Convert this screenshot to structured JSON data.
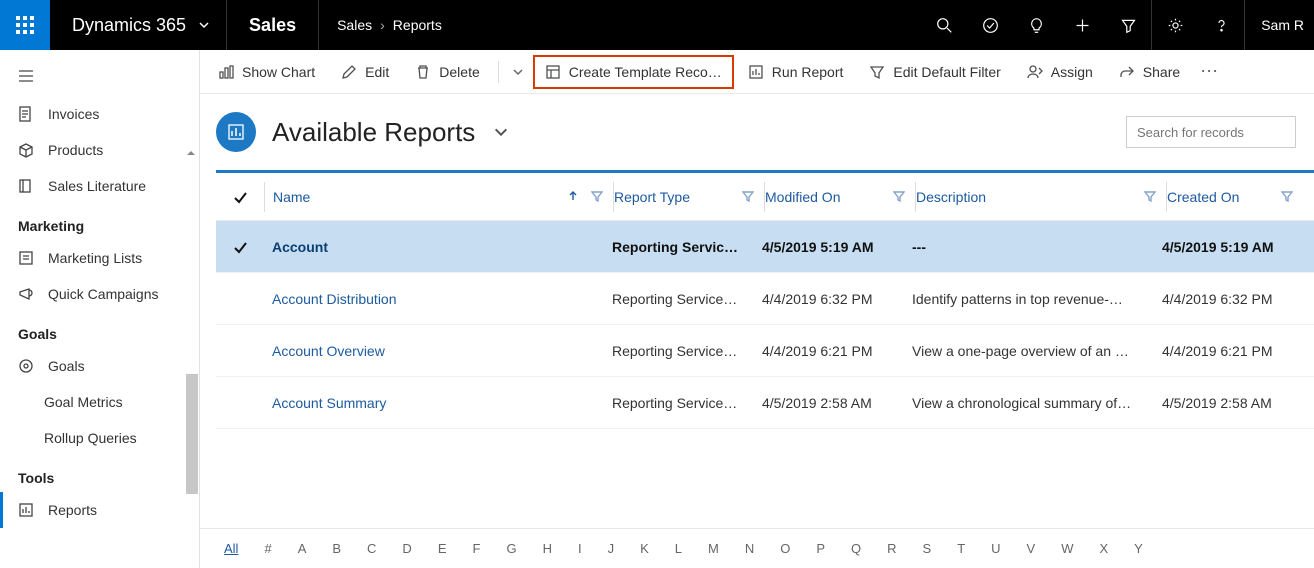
{
  "topbar": {
    "brand": "Dynamics 365",
    "area": "Sales",
    "breadcrumb": [
      "Sales",
      "Reports"
    ],
    "user": "Sam R"
  },
  "sidebar": {
    "items1": [
      {
        "label": "Invoices"
      },
      {
        "label": "Products"
      },
      {
        "label": "Sales Literature"
      }
    ],
    "group_marketing": "Marketing",
    "items2": [
      {
        "label": "Marketing Lists"
      },
      {
        "label": "Quick Campaigns"
      }
    ],
    "group_goals": "Goals",
    "items3": [
      {
        "label": "Goals"
      },
      {
        "label": "Goal Metrics"
      },
      {
        "label": "Rollup Queries"
      }
    ],
    "group_tools": "Tools",
    "items4": [
      {
        "label": "Reports"
      }
    ]
  },
  "commands": {
    "show_chart": "Show Chart",
    "edit": "Edit",
    "delete": "Delete",
    "create_template": "Create Template Reco…",
    "run_report": "Run Report",
    "edit_default_filter": "Edit Default Filter",
    "assign": "Assign",
    "share": "Share"
  },
  "view": {
    "title": "Available Reports",
    "search_placeholder": "Search for records"
  },
  "grid": {
    "columns": {
      "name": "Name",
      "report_type": "Report Type",
      "modified_on": "Modified On",
      "description": "Description",
      "created_on": "Created On"
    },
    "rows": [
      {
        "selected": true,
        "name": "Account",
        "type": "Reporting Servic…",
        "modified": "4/5/2019 5:19 AM",
        "description": "---",
        "created": "4/5/2019 5:19 AM"
      },
      {
        "selected": false,
        "name": "Account Distribution",
        "type": "Reporting Service…",
        "modified": "4/4/2019 6:32 PM",
        "description": "Identify patterns in top revenue-…",
        "created": "4/4/2019 6:32 PM"
      },
      {
        "selected": false,
        "name": "Account Overview",
        "type": "Reporting Service…",
        "modified": "4/4/2019 6:21 PM",
        "description": "View a one-page overview of an …",
        "created": "4/4/2019 6:21 PM"
      },
      {
        "selected": false,
        "name": "Account Summary",
        "type": "Reporting Service…",
        "modified": "4/5/2019 2:58 AM",
        "description": "View a chronological summary of…",
        "created": "4/5/2019 2:58 AM"
      }
    ]
  },
  "alpha": [
    "All",
    "#",
    "A",
    "B",
    "C",
    "D",
    "E",
    "F",
    "G",
    "H",
    "I",
    "J",
    "K",
    "L",
    "M",
    "N",
    "O",
    "P",
    "Q",
    "R",
    "S",
    "T",
    "U",
    "V",
    "W",
    "X",
    "Y"
  ]
}
